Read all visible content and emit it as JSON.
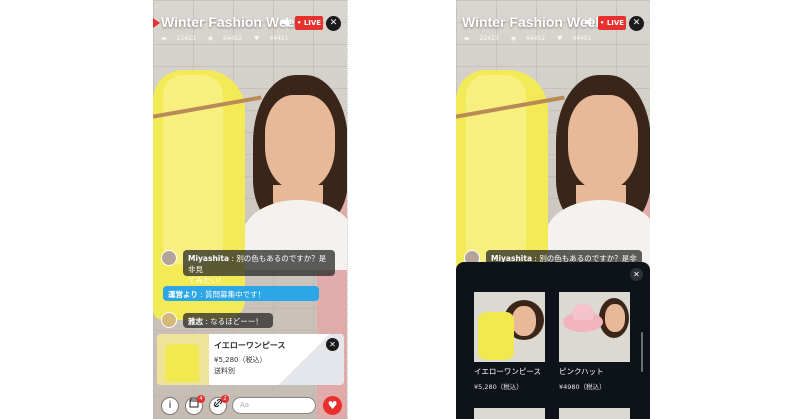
{
  "stream": {
    "title": "Winter Fashion Week",
    "live_label": "• LIVE",
    "stats": {
      "comments": "22423",
      "views": "64452",
      "likes": "44451"
    }
  },
  "chat": [
    {
      "user": "Miyashita",
      "sep": " : ",
      "text_line1": "別の色もあるのですか？是非見",
      "text_line2": "てみたい！"
    },
    {
      "user": "運営より",
      "sep": " : ",
      "text_line1": "質問募集中です！"
    },
    {
      "user": "雅志",
      "sep": " : ",
      "text_line1": "なるほどーー！"
    }
  ],
  "product": {
    "name": "イエローワンピース",
    "price": "¥5,280（税込）",
    "shipping": "送料別"
  },
  "bottom": {
    "info_icon": "i",
    "shop_badge": "4",
    "link_badge": "2",
    "input_placeholder": "Aa"
  },
  "sheet": {
    "items": [
      {
        "name": "イエローワンピース",
        "price": "¥5,280（税込）"
      },
      {
        "name": "ピンクハット",
        "price": "¥4980（税込）"
      }
    ]
  },
  "icons": {
    "close": "✕",
    "speaker": "🔈",
    "heart": "♥"
  },
  "colors": {
    "live_red": "#e8302f",
    "chat_blue": "#2ba6e6",
    "sheet_bg": "#0e1219"
  }
}
